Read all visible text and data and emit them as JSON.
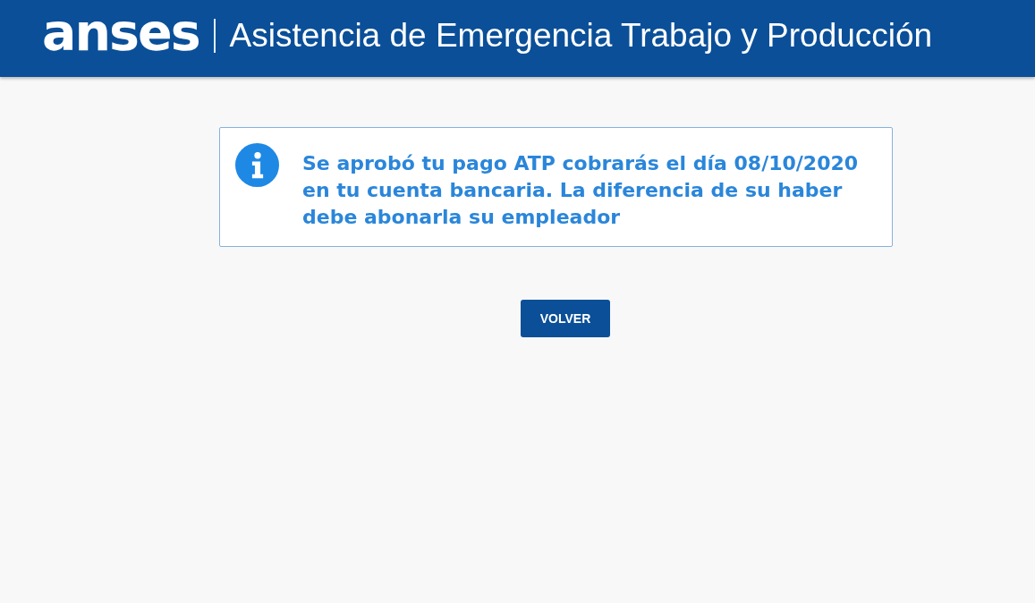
{
  "header": {
    "logo": "anses",
    "title": "Asistencia de Emergencia Trabajo y Producción"
  },
  "alert": {
    "kind": "info",
    "message": "Se aprobó tu pago ATP cobrarás el día 08/10/2020 en tu cuenta bancaria. La diferencia de su haber debe abonarla su empleador"
  },
  "buttons": [
    {
      "label": "VOLVER"
    }
  ]
}
